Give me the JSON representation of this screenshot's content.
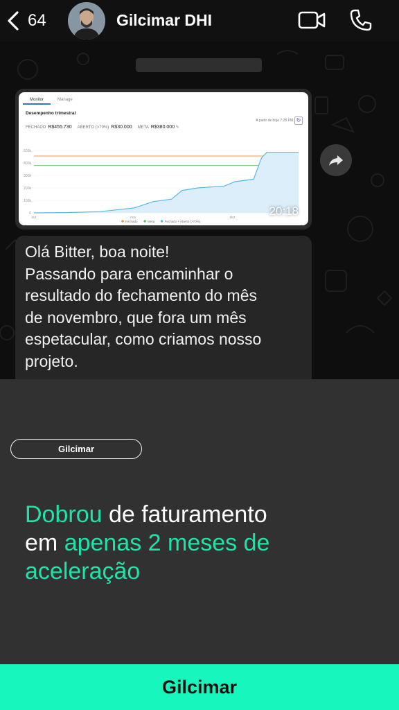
{
  "header": {
    "back_count": "64",
    "contact_name": "Gilcimar DHI"
  },
  "chat": {
    "image_message": {
      "time": "20:18",
      "screenshot": {
        "tabs": [
          "Monitor",
          "Manage"
        ],
        "title": "Desempenho trimestral",
        "kpis": [
          {
            "label": "FECHADO",
            "value": "R$455.730"
          },
          {
            "label": "ABERTO (>70%)",
            "value": "R$30.000"
          },
          {
            "label": "META",
            "value": "R$380.000"
          }
        ],
        "period": "A partir de hoje 7:28 PM",
        "chart_data": {
          "type": "line",
          "y_ticks": [
            "500k",
            "400k",
            "300k",
            "200k",
            "100k",
            "0"
          ],
          "x_ticks": [
            "out",
            "nov",
            "dez"
          ],
          "legend": [
            "Fechado",
            "Meta",
            "Fechado + Aberto (>70%)"
          ],
          "colors": [
            "#f39a4a",
            "#6cc46c",
            "#58b7e8"
          ],
          "ylim": [
            0,
            500000
          ],
          "series": [
            {
              "name": "Fechado",
              "values": [
                455730,
                455730
              ]
            },
            {
              "name": "Meta",
              "values": [
                380000,
                380000
              ]
            },
            {
              "name": "Fechado + Aberto (>70%)",
              "points": [
                [
                  0,
                  0
                ],
                [
                  0.12,
                  2000
                ],
                [
                  0.25,
                  10000
                ],
                [
                  0.38,
                  40000
                ],
                [
                  0.45,
                  90000
                ],
                [
                  0.52,
                  110000
                ],
                [
                  0.56,
                  180000
                ],
                [
                  0.62,
                  200000
                ],
                [
                  0.72,
                  215000
                ],
                [
                  0.76,
                  250000
                ],
                [
                  0.83,
                  270000
                ],
                [
                  0.86,
                  440000
                ],
                [
                  0.88,
                  485000
                ],
                [
                  1.0,
                  485000
                ]
              ]
            }
          ]
        }
      }
    },
    "text_message": {
      "lines": [
        "Olá Bitter, boa noite!",
        "Passando para encaminhar o",
        "resultado do fechamento do mês",
        "de novembro, que fora um mês",
        "espetacular, como criamos nosso",
        "projeto."
      ]
    }
  },
  "card": {
    "tag": "Gilcimar",
    "headline": {
      "line1_highlight": "Dobrou",
      "line1_rest": " de faturamento",
      "line2_plain": "em ",
      "line2_highlight": "apenas 2 meses de",
      "line3_highlight": "aceleração"
    },
    "highlight_color": "#20e2a8"
  },
  "bottom_bar": {
    "label": "Gilcimar",
    "color": "#17f6bd"
  }
}
